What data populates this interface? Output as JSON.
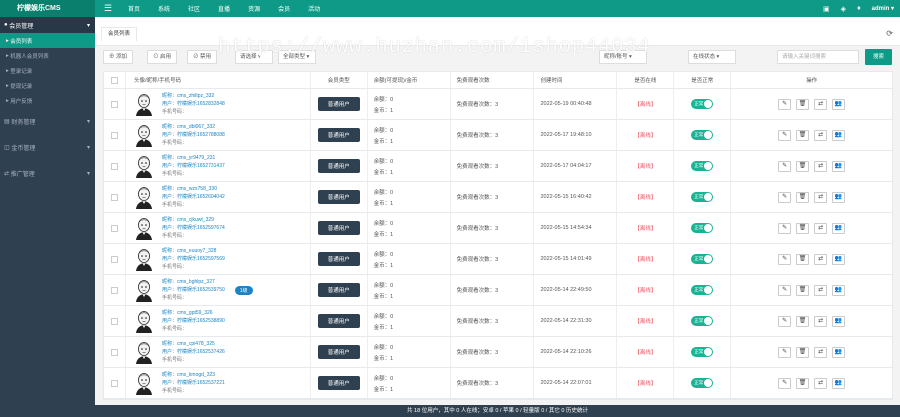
{
  "header": {
    "logo": "柠檬娱乐CMS",
    "nav": [
      "首页",
      "系统",
      "社区",
      "直播",
      "资源",
      "会员",
      "活动"
    ],
    "admin": "admin"
  },
  "sidebar": {
    "head": "会员管理",
    "items": [
      "会员列表",
      "机器人会员列表",
      "登录记录",
      "提现记录",
      "用户反馈"
    ],
    "groups": [
      "财务管理",
      "金币管理",
      "推广管理"
    ]
  },
  "tab": {
    "label": "会员列表"
  },
  "toolbar": {
    "add": "添加",
    "enable": "启用",
    "disable": "禁用",
    "select1": "请选择",
    "select2": "全部类型",
    "select3": "昵称/账号",
    "select4": "在线状态",
    "search_placeholder": "请输入关键词搜索",
    "search_btn": "搜索"
  },
  "table": {
    "headers": [
      "",
      "头像/昵称/手机号码",
      "会员类型",
      "余额(可提现)/金币",
      "免费观看次数",
      "创建时间",
      "是否在线",
      "是否正常",
      "操作"
    ],
    "rows": [
      {
        "nick": "昵称：cms_zhiltpz_332",
        "name": "用户：柠檬娱乐1652832848",
        "phone": "手机号码：",
        "badge": "",
        "type": "普通用户",
        "balance": "余额：0",
        "gold": "金币：1",
        "free": "免费观看次数：3",
        "created": "2022-05-19 00:40:48",
        "online": "【离线】",
        "normal": "正常"
      },
      {
        "nick": "昵称：cms_dbl067_332",
        "name": "用户：柠檬娱乐1652788088",
        "phone": "手机号码：",
        "badge": "",
        "type": "普通用户",
        "balance": "余额：0",
        "gold": "金币：1",
        "free": "免费观看次数：3",
        "created": "2022-05-17 19:48:10",
        "online": "【离线】",
        "normal": "正常"
      },
      {
        "nick": "昵称：cms_yr9479_231",
        "name": "用户：柠檬娱乐1652731437",
        "phone": "手机号码：",
        "badge": "",
        "type": "普通用户",
        "balance": "余额：0",
        "gold": "金币：1",
        "free": "免费观看次数：3",
        "created": "2022-05-17 04:04:17",
        "online": "【离线】",
        "normal": "正常"
      },
      {
        "nick": "昵称：cms_wzx758_330",
        "name": "用户：柠檬娱乐1652604042",
        "phone": "手机号码：",
        "badge": "",
        "type": "普通用户",
        "balance": "余额：0",
        "gold": "金币：1",
        "free": "免费观看次数：3",
        "created": "2022-05-15 16:40:42",
        "online": "【离线】",
        "normal": "正常"
      },
      {
        "nick": "昵称：cms_cjkuwt_329",
        "name": "用户：柠檬娱乐1652597674",
        "phone": "手机号码：",
        "badge": "",
        "type": "普通用户",
        "balance": "余额：0",
        "gold": "金币：1",
        "free": "免费观看次数：3",
        "created": "2022-05-15 14:54:34",
        "online": "【离线】",
        "normal": "正常"
      },
      {
        "nick": "昵称：cms_euuoy7_328",
        "name": "用户：柠檬娱乐1652597569",
        "phone": "手机号码：",
        "badge": "",
        "type": "普通用户",
        "balance": "余额：0",
        "gold": "金币：1",
        "free": "免费观看次数：3",
        "created": "2022-05-15 14:01:49",
        "online": "【离线】",
        "normal": "正常"
      },
      {
        "nick": "昵称：cms_bghlpz_327",
        "name": "用户：柠檬娱乐1652539750",
        "phone": "手机号码：",
        "badge": "1级",
        "type": "普通用户",
        "balance": "余额：0",
        "gold": "金币：1",
        "free": "免费观看次数：3",
        "created": "2022-05-14 22:49:50",
        "online": "【离线】",
        "normal": "正常"
      },
      {
        "nick": "昵称：cms_gpt59_326",
        "name": "用户：柠檬娱乐1652538890",
        "phone": "手机号码：",
        "badge": "",
        "type": "普通用户",
        "balance": "余额：0",
        "gold": "金币：1",
        "free": "免费观看次数：3",
        "created": "2022-05-14 22:31:30",
        "online": "【离线】",
        "normal": "正常"
      },
      {
        "nick": "昵称：cms_cpi478_325",
        "name": "用户：柠檬娱乐1652537426",
        "phone": "手机号码：",
        "badge": "",
        "type": "普通用户",
        "balance": "余额：0",
        "gold": "金币：1",
        "free": "免费观看次数：3",
        "created": "2022-05-14 22:10:26",
        "online": "【离线】",
        "normal": "正常"
      },
      {
        "nick": "昵称：cms_kmogd_323",
        "name": "用户：柠檬娱乐1652537221",
        "phone": "手机号码：",
        "badge": "",
        "type": "普通用户",
        "balance": "余额：0",
        "gold": "金币：1",
        "free": "免费观看次数：3",
        "created": "2022-05-14 22:07:01",
        "online": "【离线】",
        "normal": "正常"
      }
    ]
  },
  "footer": "共 18 位用户，其中 0 人在线；安卓 0 / 苹果 0 / 轻量版 0 / 其它 0    历史统计",
  "watermark": "https://www.huzhan.com/ishop44034",
  "colors": {
    "accent": "#0e9a86",
    "sidebar": "#2f4050",
    "danger": "#ed5565"
  }
}
